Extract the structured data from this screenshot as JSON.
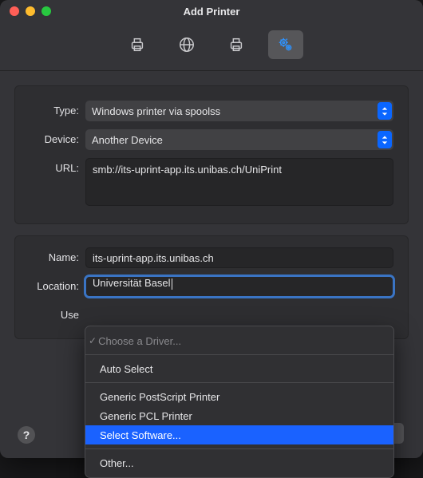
{
  "window": {
    "title": "Add Printer"
  },
  "toolbar": {
    "items": [
      {
        "name": "default-printers-icon"
      },
      {
        "name": "ip-printers-icon"
      },
      {
        "name": "windows-printers-icon"
      },
      {
        "name": "advanced-icon"
      }
    ],
    "active_index": 3
  },
  "form": {
    "type_label": "Type:",
    "type_value": "Windows printer via spoolss",
    "device_label": "Device:",
    "device_value": "Another Device",
    "url_label": "URL:",
    "url_value": "smb://its-uprint-app.its.unibas.ch/UniPrint",
    "name_label": "Name:",
    "name_value": "its-uprint-app.its.unibas.ch",
    "location_label": "Location:",
    "location_value": "Universität Basel",
    "use_label": "Use"
  },
  "dropdown": {
    "header": "Choose a Driver...",
    "items": [
      "Auto Select",
      "Generic PostScript Printer",
      "Generic PCL Printer",
      "Select Software...",
      "Other..."
    ],
    "selected_index": 3,
    "sep_after": [
      0,
      3
    ]
  },
  "help_glyph": "?",
  "colors": {
    "accent": "#1a62ff"
  }
}
